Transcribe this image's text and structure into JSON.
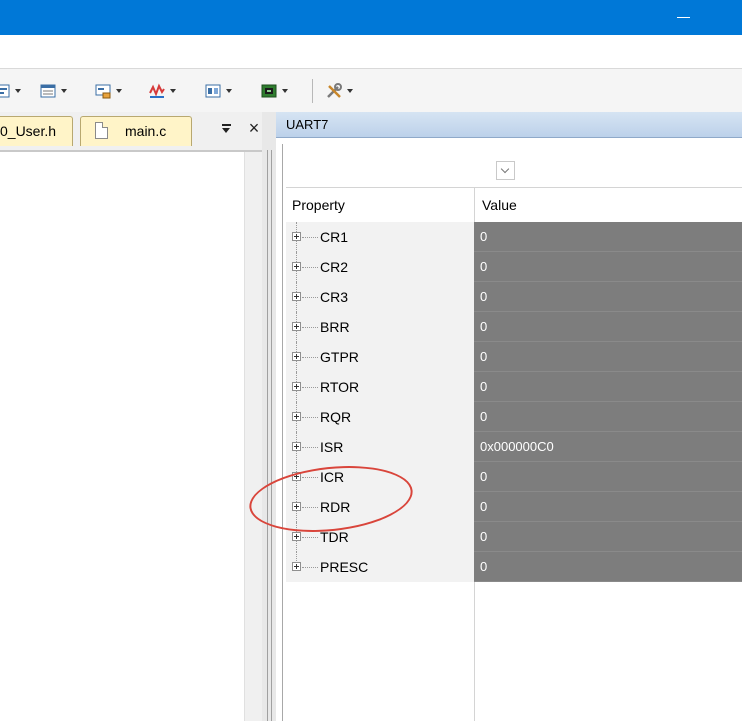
{
  "colors": {
    "titlebar": "#0078d7",
    "value_cell": "#7d7d7d",
    "tab_active": "#fff4c8",
    "annotation": "#d9453b"
  },
  "toolbar": {
    "icons": [
      "watch-window-icon",
      "memory-window-icon",
      "serial-window-icon",
      "analysis-window-icon",
      "trace-window-icon",
      "system-viewer-icon",
      "toolbox-icon"
    ]
  },
  "editor": {
    "tabs": [
      {
        "label": "0_User.h"
      },
      {
        "label": "main.c"
      }
    ]
  },
  "panel": {
    "title": "UART7",
    "columns": {
      "property": "Property",
      "value": "Value"
    },
    "registers": [
      {
        "name": "CR1",
        "value": "0"
      },
      {
        "name": "CR2",
        "value": "0"
      },
      {
        "name": "CR3",
        "value": "0"
      },
      {
        "name": "BRR",
        "value": "0"
      },
      {
        "name": "GTPR",
        "value": "0"
      },
      {
        "name": "RTOR",
        "value": "0"
      },
      {
        "name": "RQR",
        "value": "0"
      },
      {
        "name": "ISR",
        "value": "0x000000C0"
      },
      {
        "name": "ICR",
        "value": "0"
      },
      {
        "name": "RDR",
        "value": "0"
      },
      {
        "name": "TDR",
        "value": "0"
      },
      {
        "name": "PRESC",
        "value": "0"
      }
    ]
  }
}
